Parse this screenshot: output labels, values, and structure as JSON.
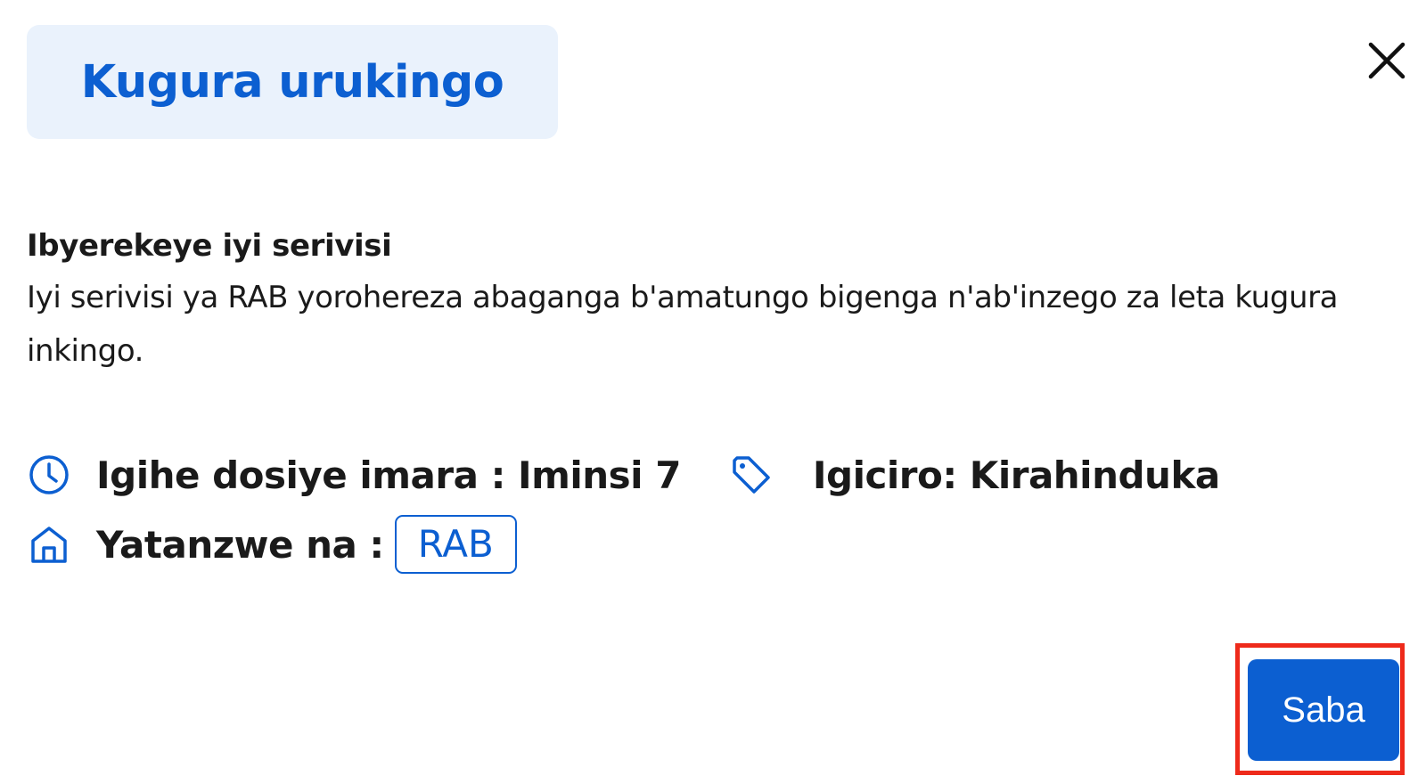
{
  "dialog": {
    "title": "Kugura urukingo",
    "close_icon": "close-icon"
  },
  "about": {
    "heading": "Ibyerekeye iyi serivisi",
    "description": "Iyi serivisi ya RAB yorohereza abaganga b'amatungo bigenga n'ab'inzego za leta kugura inkingo."
  },
  "meta": {
    "processing_time": {
      "icon": "clock-icon",
      "label": "Igihe dosiye imara : Iminsi 7"
    },
    "price": {
      "icon": "tag-icon",
      "label": "Igiciro: Kirahinduka"
    },
    "provider": {
      "icon": "home-icon",
      "label": "Yatanzwe na :",
      "agency": "RAB"
    }
  },
  "actions": {
    "request_label": "Saba"
  },
  "colors": {
    "accent": "#0c5fd1",
    "title_background": "#eaf2fc",
    "highlight": "#ee2a1b"
  }
}
